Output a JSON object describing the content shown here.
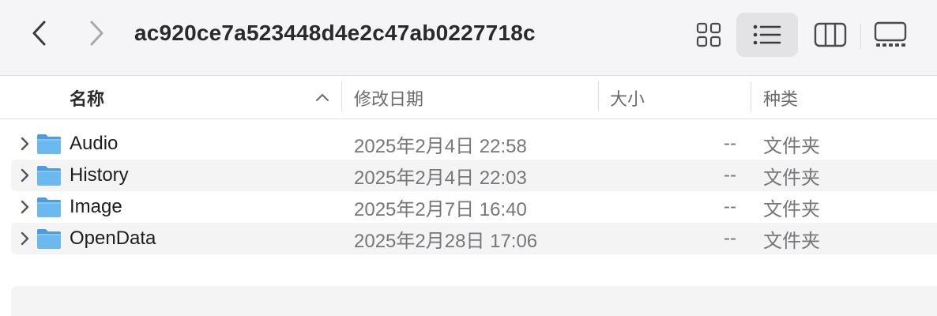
{
  "window": {
    "title": "ac920ce7a523448d4e2c47ab0227718c"
  },
  "toolbar": {
    "back_icon": "chevron-left-icon",
    "forward_icon": "chevron-right-icon",
    "views": [
      {
        "name": "icon-view",
        "icon": "grid-icon",
        "selected": false
      },
      {
        "name": "list-view",
        "icon": "list-icon",
        "selected": true
      },
      {
        "name": "column-view",
        "icon": "columns-icon",
        "selected": false
      },
      {
        "name": "gallery-view",
        "icon": "gallery-icon",
        "selected": false
      }
    ]
  },
  "columns": {
    "name": "名称",
    "date": "修改日期",
    "size": "大小",
    "kind": "种类",
    "sort": "ascending"
  },
  "files": [
    {
      "name": "Audio",
      "date": "2025年2月4日 22:58",
      "size": "--",
      "kind": "文件夹"
    },
    {
      "name": "History",
      "date": "2025年2月4日 22:03",
      "size": "--",
      "kind": "文件夹"
    },
    {
      "name": "Image",
      "date": "2025年2月7日 16:40",
      "size": "--",
      "kind": "文件夹"
    },
    {
      "name": "OpenData",
      "date": "2025年2月28日 17:06",
      "size": "--",
      "kind": "文件夹"
    }
  ],
  "colors": {
    "folder": "#5aaee8",
    "selected_view_bg": "#e3e3e6",
    "alt_row": "#f4f4f5"
  }
}
